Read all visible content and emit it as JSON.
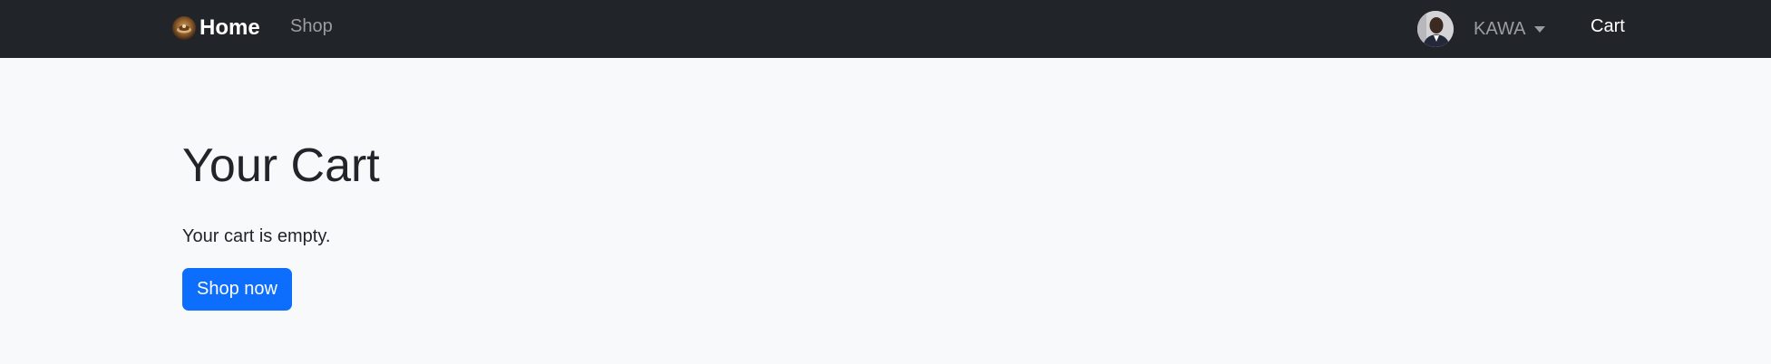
{
  "navbar": {
    "brand_label": "Home",
    "brand_icon": "coffee-logo-icon",
    "shop_link": "Shop",
    "user_name": "KAWA",
    "cart_link": "Cart"
  },
  "main": {
    "title": "Your Cart",
    "empty_message": "Your cart is empty.",
    "shop_now_label": "Shop now"
  },
  "colors": {
    "navbar_bg": "#212529",
    "page_bg": "#f8f9fa",
    "primary_button": "#0d6efd"
  }
}
